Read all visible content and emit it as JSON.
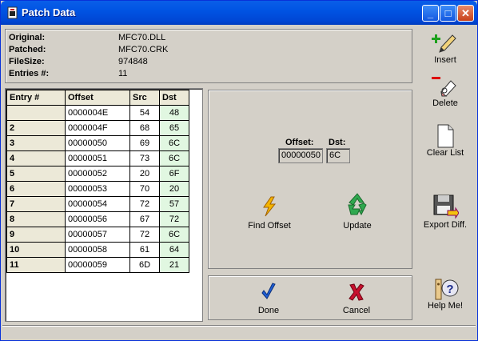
{
  "window": {
    "title": "Patch Data",
    "minimize": "_",
    "maximize": "□",
    "close": "✕"
  },
  "info": {
    "original_label": "Original:",
    "original_value": "MFC70.DLL",
    "patched_label": "Patched:",
    "patched_value": "MFC70.CRK",
    "filesize_label": "FileSize:",
    "filesize_value": "974848",
    "entries_label": "Entries #:",
    "entries_value": "11"
  },
  "grid": {
    "headers": [
      "Entry #",
      "Offset",
      "Src",
      "Dst"
    ],
    "rows": [
      {
        "entry": "",
        "offset": "0000004E",
        "src": "54",
        "dst": "48"
      },
      {
        "entry": "2",
        "offset": "0000004F",
        "src": "68",
        "dst": "65"
      },
      {
        "entry": "3",
        "offset": "00000050",
        "src": "69",
        "dst": "6C"
      },
      {
        "entry": "4",
        "offset": "00000051",
        "src": "73",
        "dst": "6C"
      },
      {
        "entry": "5",
        "offset": "00000052",
        "src": "20",
        "dst": "6F"
      },
      {
        "entry": "6",
        "offset": "00000053",
        "src": "70",
        "dst": "20"
      },
      {
        "entry": "7",
        "offset": "00000054",
        "src": "72",
        "dst": "57"
      },
      {
        "entry": "8",
        "offset": "00000056",
        "src": "67",
        "dst": "72"
      },
      {
        "entry": "9",
        "offset": "00000057",
        "src": "72",
        "dst": "6C"
      },
      {
        "entry": "10",
        "offset": "00000058",
        "src": "61",
        "dst": "64"
      },
      {
        "entry": "11",
        "offset": "00000059",
        "src": "6D",
        "dst": "21"
      }
    ]
  },
  "editor": {
    "offset_label": "Offset:",
    "offset_value": "00000050",
    "dst_label": "Dst:",
    "dst_value": "6C",
    "find_offset": "Find Offset",
    "update": "Update"
  },
  "actions": {
    "done": "Done",
    "cancel": "Cancel"
  },
  "side": {
    "insert": "Insert",
    "delete": "Delete",
    "clear_list": "Clear List",
    "export_diff": "Export Diff.",
    "help": "Help Me!"
  }
}
